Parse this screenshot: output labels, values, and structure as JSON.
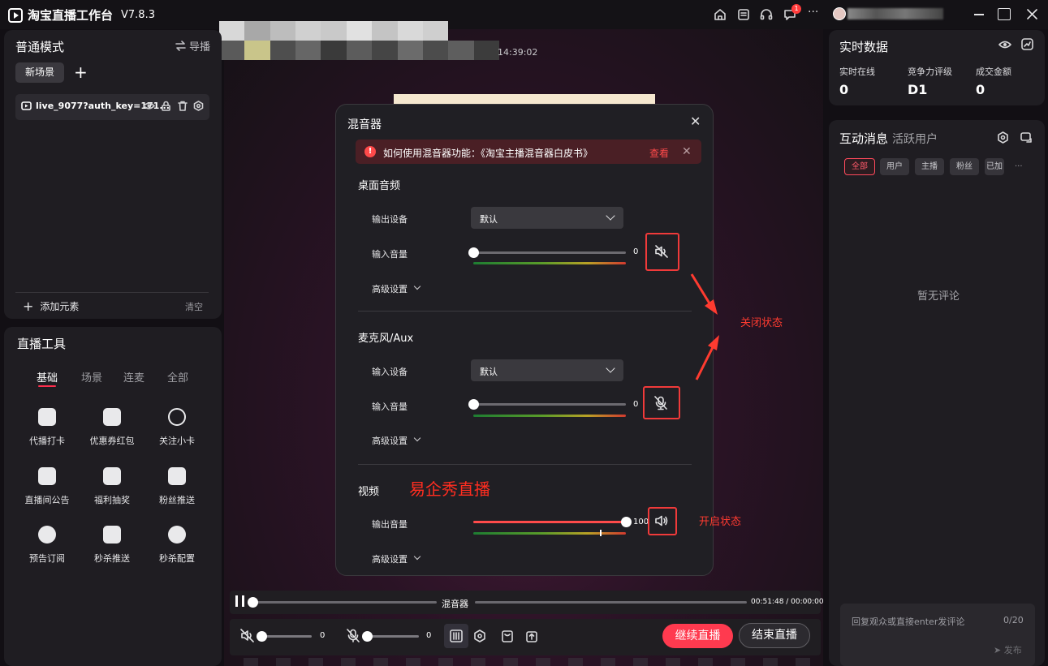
{
  "app": {
    "title": "淘宝直播工作台",
    "version": "V7.8.3",
    "notification_count": "1"
  },
  "stage": {
    "time": "14:39:02"
  },
  "scene_panel": {
    "mode": "普通模式",
    "guide_label": "导播",
    "scene_tab": "新场景",
    "add_scene": "+",
    "source_name": "live_9077?auth_key=171...",
    "add_element": "添加元素",
    "clear": "清空"
  },
  "tools": {
    "title": "直播工具",
    "tabs": [
      "基础",
      "场景",
      "连麦",
      "全部"
    ],
    "items": [
      {
        "label": "代播打卡",
        "icon": "calendar-check-icon"
      },
      {
        "label": "优惠券红包",
        "icon": "coupon-envelope-icon"
      },
      {
        "label": "关注小卡",
        "icon": "broadcast-icon"
      },
      {
        "label": "直播间公告",
        "icon": "speaker-icon"
      },
      {
        "label": "福利抽奖",
        "icon": "gift-icon"
      },
      {
        "label": "粉丝推送",
        "icon": "push-icon"
      },
      {
        "label": "预告订阅",
        "icon": "subscribe-icon"
      },
      {
        "label": "秒杀推送",
        "icon": "flash-push-icon"
      },
      {
        "label": "秒杀配置",
        "icon": "flash-config-icon"
      }
    ]
  },
  "realtime": {
    "title": "实时数据",
    "stats": [
      {
        "label": "实时在线",
        "value": "0"
      },
      {
        "label": "竞争力评级",
        "value": "D1"
      },
      {
        "label": "成交金额",
        "value": "0"
      }
    ]
  },
  "messages": {
    "title": "互动消息",
    "subtitle": "活跃用户",
    "chips": [
      "全部",
      "用户",
      "主播",
      "粉丝",
      "已加"
    ],
    "more": "...",
    "empty": "暂无评论",
    "reply_placeholder": "回复观众或直接enter发评论",
    "reply_count": "0/20",
    "publish": "发布"
  },
  "playback": {
    "mixer_label": "混音器",
    "time": "00:51:48 / 00:00:00"
  },
  "controls": {
    "speaker_volume": "0",
    "mic_volume": "0",
    "continue_label": "继续直播",
    "end_label": "结束直播"
  },
  "mixer": {
    "title": "混音器",
    "tip_text": "如何使用混音器功能：《淘宝主播混音器白皮书》",
    "tip_link": "查看",
    "desktop": {
      "title": "桌面音频",
      "device_label": "输出设备",
      "device_value": "默认",
      "volume_label": "输入音量",
      "volume": "0",
      "volume_level": 0,
      "advanced": "高级设置"
    },
    "mic": {
      "title": "麦克风/Aux",
      "device_label": "输入设备",
      "device_value": "默认",
      "volume_label": "输入音量",
      "volume": "0",
      "volume_level": 0,
      "advanced": "高级设置"
    },
    "video": {
      "title": "视频",
      "volume_label": "输出音量",
      "volume": "100",
      "volume_level": 100,
      "advanced": "高级设置"
    }
  },
  "annotations": {
    "closed_state": "关闭状态",
    "open_state": "开启状态",
    "brand": "易企秀直播",
    "color": "#ff3b30"
  }
}
